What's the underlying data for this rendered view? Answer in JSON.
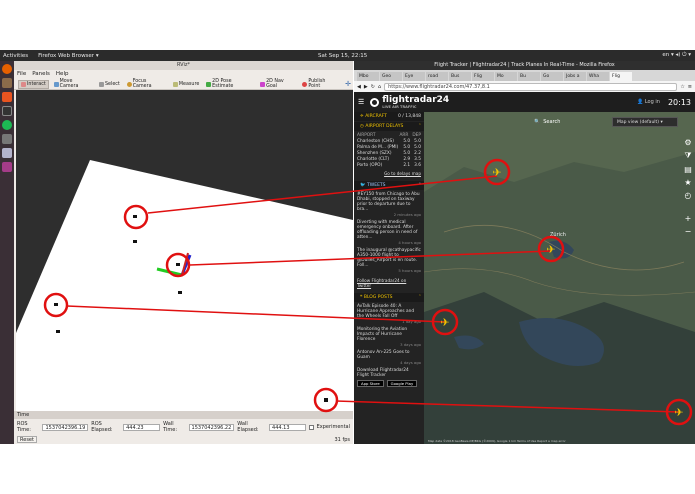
{
  "topbar": {
    "activities": "Activities",
    "app_label": "Firefox Web Browser ▾",
    "clock": "Sat Sep 15, 22:15",
    "tray": "en ▾  ◂)  ⏻ ▾"
  },
  "launcher": {
    "icons": [
      "firefox-icon",
      "files-icon",
      "software-icon",
      "terminal-icon",
      "spotify-icon",
      "settings-icon",
      "rviz-icon",
      "update-icon"
    ]
  },
  "rviz": {
    "title": "RViz*",
    "menu": [
      "File",
      "Panels",
      "Help"
    ],
    "tools": [
      {
        "label": "Interact",
        "active": true
      },
      {
        "label": "Move Camera"
      },
      {
        "label": "Select"
      },
      {
        "label": "Focus Camera"
      },
      {
        "label": "Measure"
      },
      {
        "label": "2D Pose Estimate"
      },
      {
        "label": "2D Nav Goal"
      },
      {
        "label": "Publish Point"
      }
    ],
    "time_panel": {
      "header": "Time",
      "ros_time_label": "ROS Time:",
      "ros_time": "1537042396.19",
      "ros_elapsed_label": "ROS Elapsed:",
      "ros_elapsed": "444.23",
      "wall_time_label": "Wall Time:",
      "wall_time": "1537042396.22",
      "wall_elapsed_label": "Wall Elapsed:",
      "wall_elapsed": "444.13",
      "experimental_label": "Experimental",
      "reset_label": "Reset",
      "fps": "31 fps"
    }
  },
  "firefox": {
    "title": "Flight Tracker | Flightradar24 | Track Planes In Real-Time - Mozilla Firefox",
    "tabs": [
      "Mbo",
      "Geo",
      "Eye",
      "road",
      "Bus",
      "Flig",
      "Mo",
      "Bu",
      "Go",
      "Jobs a",
      "Wha",
      "Flig"
    ],
    "url": "https://www.flightradar24.com/47.37,8.1"
  },
  "fr": {
    "logo": "flightradar24",
    "logo_sub": "LIVE AIR TRAFFIC",
    "login": "Log in",
    "clock": "20:13",
    "aircraft_label": "AIRCRAFT",
    "aircraft_count": "0 / 13,848",
    "delays_label": "AIRPORT DELAYS",
    "delays_cols": [
      "AIRPORT",
      "ARR",
      "DEP"
    ],
    "delays": [
      {
        "name": "Charleston (CHS)",
        "arr": "5.0",
        "dep": "5.0"
      },
      {
        "name": "Palma de M... (PMI)",
        "arr": "5.0",
        "dep": "5.0"
      },
      {
        "name": "Shenzhen (SZX)",
        "arr": "5.0",
        "dep": "2.2"
      },
      {
        "name": "Charlotte (CLT)",
        "arr": "2.9",
        "dep": "3.5"
      },
      {
        "name": "Porto (OPO)",
        "arr": "2.1",
        "dep": "3.6"
      }
    ],
    "delays_more": "Go to delays map",
    "tweets_label": "TWEETS",
    "tweets": [
      {
        "text": "#EY150 from Chicago to Abu Dhabi, stopped on taxiway prior to departure due to bra...",
        "time": "2 minutes ago"
      },
      {
        "text": "Diverting with medical emergency onboard. After offloading person in need of atten...",
        "time": "4 hours ago"
      },
      {
        "text": "The inaugural @cathaypacific A350-1000 flight to @Dulles_Airport is en route. Foll...",
        "time": "5 hours ago"
      }
    ],
    "follow": "Follow Flightradar24 on Twitter",
    "blog_label": "BLOG POSTS",
    "blog": [
      {
        "text": "AvTalk Episode 40: A Hurricane Approaches and the Wheels Fall Off",
        "time": "1 day ago"
      },
      {
        "text": "Monitoring the Aviation Impacts of Hurricane Florence",
        "time": "3 days ago"
      },
      {
        "text": "Antonov An-225 Goes to Guam",
        "time": "4 days ago"
      }
    ],
    "download": "Download Flightradar24 Flight Tracker",
    "appstore": "App Store",
    "googleplay": "Google Play",
    "search": "Search",
    "map_view": "Map view (default)",
    "city": "Zürich",
    "attribution": "Map data ©2018 GeoBasis-DE/BKG (©2009), Google   1 km   Terms of Use   Report a map error"
  },
  "colors": {
    "annotation": "#e01010",
    "fr_yellow": "#f2c400",
    "map_bg": "#3d4a3e"
  }
}
